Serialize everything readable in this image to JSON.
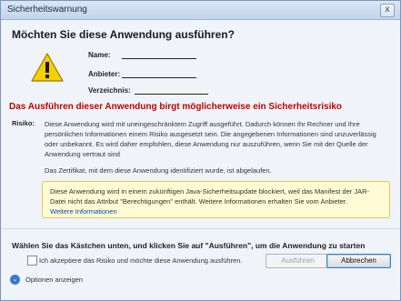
{
  "window": {
    "title": "Sicherheitswarnung",
    "close_glyph": "x"
  },
  "dialog": {
    "heading": "Möchten Sie diese Anwendung ausführen?",
    "icon": "warning-icon",
    "info": {
      "name_label": "Name:",
      "publisher_label": "Anbieter:",
      "directory_label": "Verzeichnis:"
    },
    "risk_title": "Das Ausführen dieser Anwendung birgt möglicherweise ein Sicherheitsrisiko",
    "risk_label": "Risiko:",
    "risk_text": "Diese Anwendung wird mit uneingeschränktem Zugriff ausgeführt. Dadurch können Ihr Rechner und Ihre persönlichen Informationen einem Risiko ausgesetzt sein. Die angegebenen Informationen sind unzuverlässig oder unbekannt. Es wird daher empfohlen, diese Anwendung nur auszuführen, wenn Sie mit der Quelle der Anwendung vertraut sind",
    "certificate_text": "Das Zertifikat, mit dem diese Anwendung identifiziert wurde, ist abgelaufen.",
    "notice_text": "Diese Anwendung wird in einem zukünftigen Java-Sicherheitsupdate blockiert, weil das Manifest der JAR-Datei nicht das Attribut \"Berechtigungen\" enthält. Weitere Informationen erhalten Sie vom Anbieter.",
    "notice_link": "Weitere Informationen",
    "footer_instruction": "Wählen Sie das Kästchen unten, und klicken Sie auf \"Ausführen\", um die Anwendung zu starten",
    "checkbox_label": "Ich akzeptiere das Risiko und möchte diese Anwendung ausführen.",
    "checkbox_checked": false,
    "run_button": "Ausführen",
    "cancel_button": "Abbrechen",
    "options_label": "Optionen anzeigen"
  },
  "colors": {
    "accent_red": "#c00000",
    "link_blue": "#0645ad",
    "notice_bg": "#fefbd5",
    "warning_yellow": "#f5d000"
  }
}
